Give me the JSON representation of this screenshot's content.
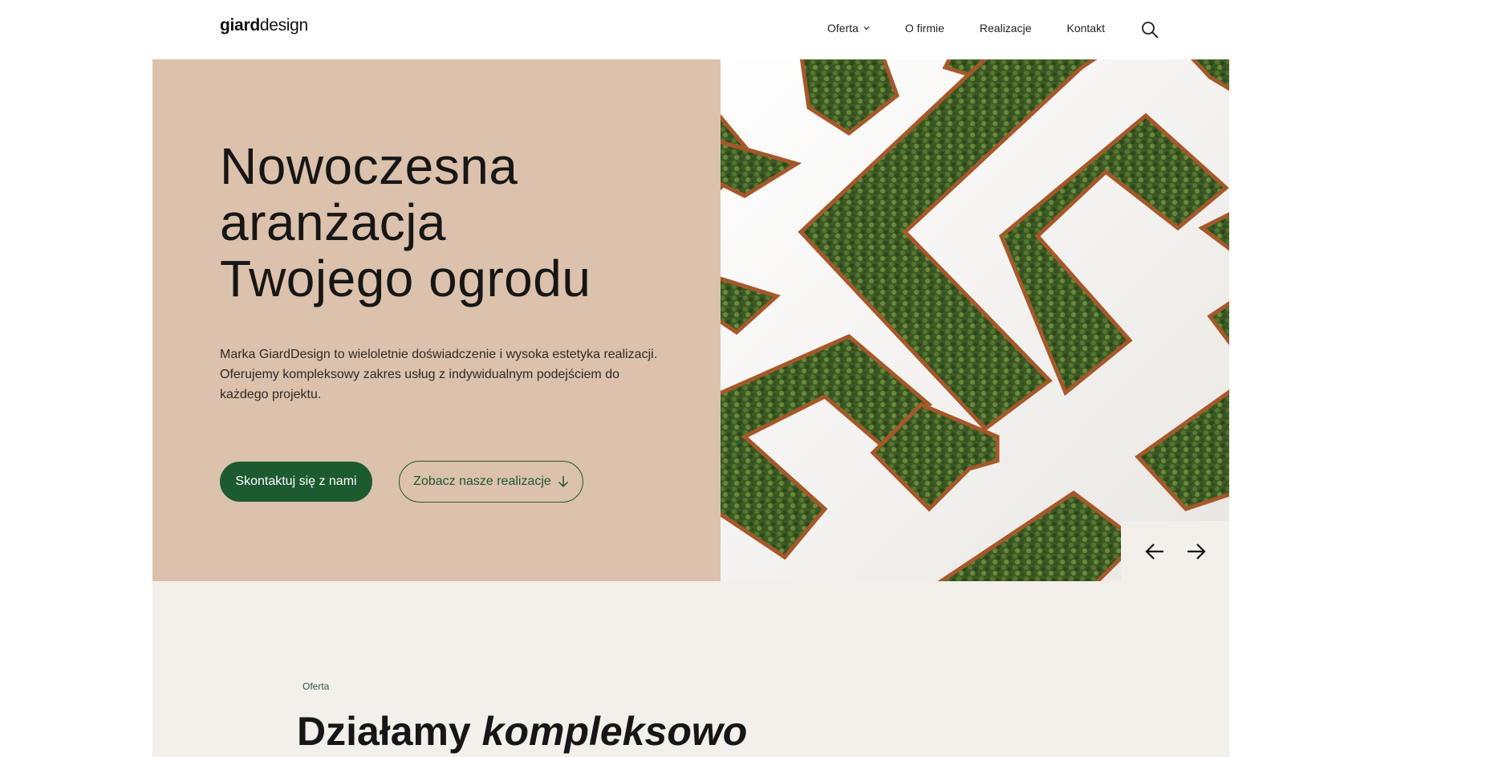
{
  "header": {
    "logo_bold": "giard",
    "logo_light": "design",
    "nav": [
      {
        "label": "Oferta",
        "has_dropdown": true
      },
      {
        "label": "O firmie"
      },
      {
        "label": "Realizacje"
      },
      {
        "label": "Kontakt"
      }
    ],
    "search_icon": "search-icon"
  },
  "hero": {
    "title_lines": [
      "Nowoczesna",
      "aranżacja",
      "Twojego ogrodu"
    ],
    "description": "Marka GiardDesign to wieloletnie doświadczenie i wysoka estetyka realizacji. Oferujemy kompleksowy zakres usług z indywidualnym podejściem do każdego projektu.",
    "primary_button": "Skontaktuj się z nami",
    "secondary_button": "Zobacz nasze realizacje",
    "image_alt": "garden-maze-image"
  },
  "slider": {
    "prev_icon": "arrow-left-icon",
    "next_icon": "arrow-right-icon"
  },
  "section": {
    "eyebrow": "Oferta",
    "title_plain": "Działamy ",
    "title_italic": "kompleksowo"
  },
  "colors": {
    "hero_bg": "#dcc1ac",
    "section_bg": "#f3efeb",
    "accent_green": "#1c5a30"
  }
}
